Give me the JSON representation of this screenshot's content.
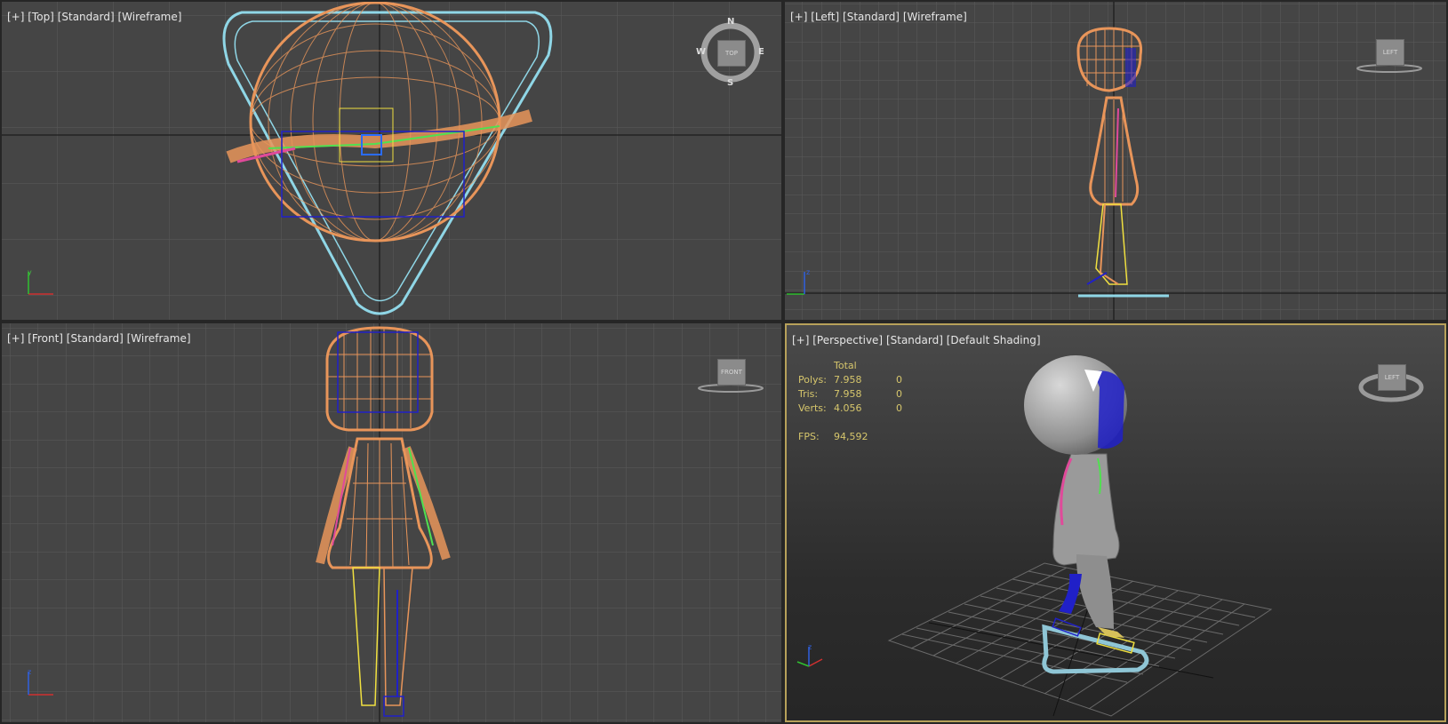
{
  "viewports": {
    "top": {
      "label": [
        "[+]",
        "[Top]",
        "[Standard]",
        "[Wireframe]"
      ],
      "compass": {
        "n": "N",
        "s": "S",
        "e": "E",
        "w": "W",
        "cube": "TOP"
      }
    },
    "left": {
      "label": [
        "[+]",
        "[Left]",
        "[Standard]",
        "[Wireframe]"
      ],
      "cube": "LEFT"
    },
    "front": {
      "label": [
        "[+]",
        "[Front]",
        "[Standard]",
        "[Wireframe]"
      ],
      "cube": "FRONT"
    },
    "perspective": {
      "label": [
        "[+]",
        "[Perspective]",
        "[Standard]",
        "[Default Shading]"
      ],
      "cube": "LEFT"
    }
  },
  "stats": {
    "header": "Total",
    "rows": [
      {
        "label": "Polys:",
        "total": "7.958",
        "sel": "0"
      },
      {
        "label": "Tris:",
        "total": "7.958",
        "sel": "0"
      },
      {
        "label": "Verts:",
        "total": "4.056",
        "sel": "0"
      }
    ],
    "fps_label": "FPS:",
    "fps_value": "94,592"
  },
  "axis_labels": {
    "x": "x",
    "y": "y",
    "z": "z"
  },
  "colors": {
    "wire_orange": "#e8955a",
    "wire_cyan": "#8fd6e6",
    "bone_blue": "#2020c8",
    "bone_green": "#50e050",
    "bone_pink": "#e04a9a",
    "active_border": "#b7a15a"
  }
}
